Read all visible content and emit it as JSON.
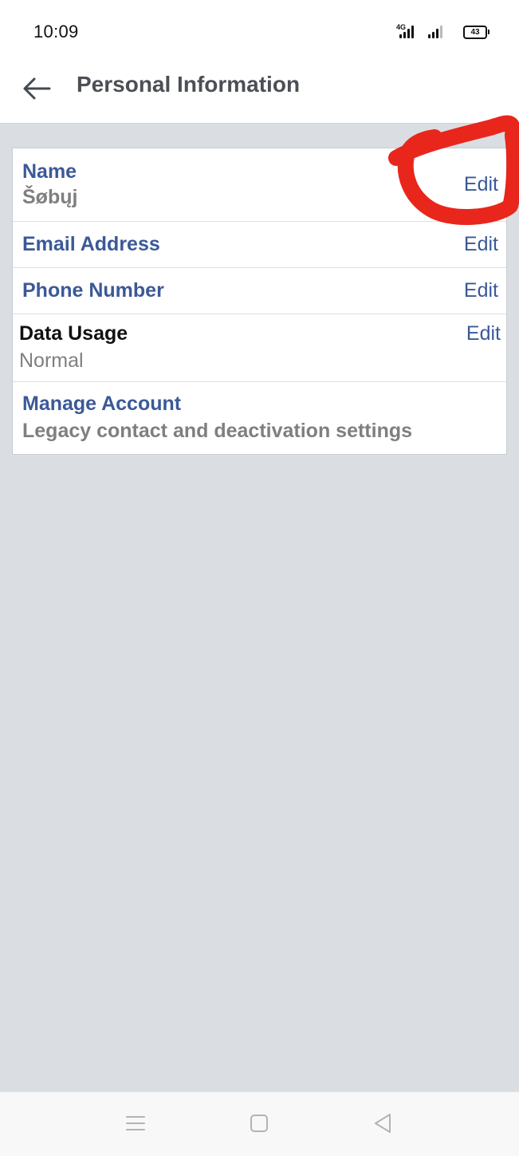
{
  "status_bar": {
    "time": "10:09",
    "network": "4G",
    "battery": "43"
  },
  "header": {
    "title": "Personal Information",
    "back_icon": "arrow-left-icon"
  },
  "rows": [
    {
      "title": "Name",
      "value": "Šøbųj",
      "action": "Edit"
    },
    {
      "title": "Email Address",
      "action": "Edit"
    },
    {
      "title": "Phone Number",
      "action": "Edit"
    },
    {
      "title": "Data Usage",
      "value": "Normal",
      "action": "Edit"
    },
    {
      "title": "Manage Account",
      "value": "Legacy contact and deactivation settings"
    }
  ],
  "nav_bar": {
    "icons": [
      "menu-icon",
      "home-square-icon",
      "back-triangle-icon"
    ]
  },
  "colors": {
    "link": "#3b5998",
    "secondary_text": "#7f7f7f",
    "background": "#dadde2",
    "annotation": "#e8261b"
  }
}
